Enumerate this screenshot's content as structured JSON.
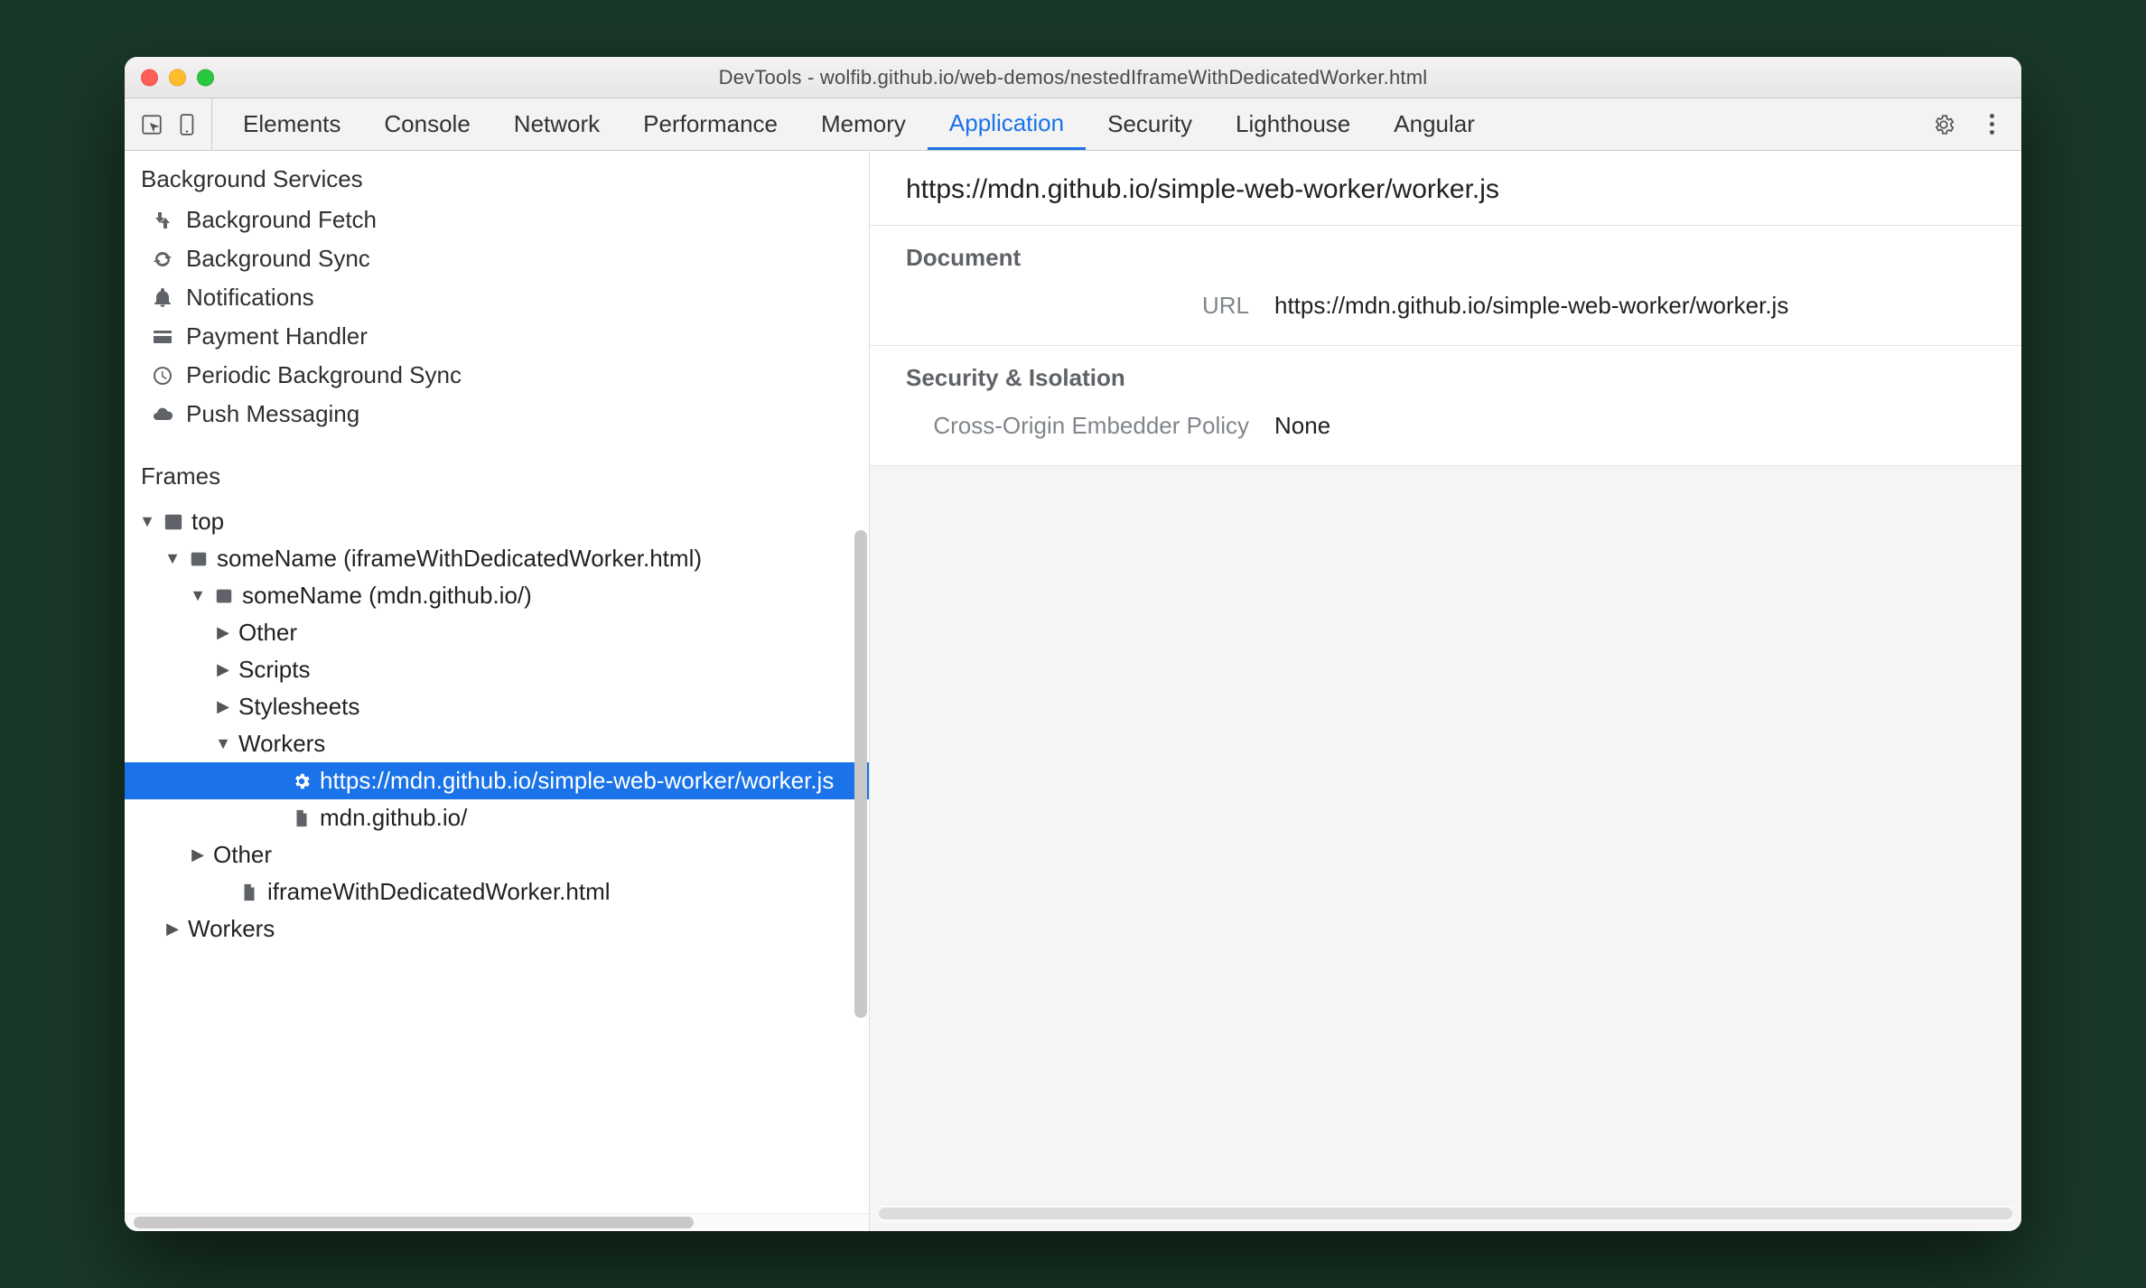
{
  "window": {
    "title": "DevTools - wolfib.github.io/web-demos/nestedIframeWithDedicatedWorker.html"
  },
  "tabs": [
    {
      "label": "Elements",
      "active": false
    },
    {
      "label": "Console",
      "active": false
    },
    {
      "label": "Network",
      "active": false
    },
    {
      "label": "Performance",
      "active": false
    },
    {
      "label": "Memory",
      "active": false
    },
    {
      "label": "Application",
      "active": true
    },
    {
      "label": "Security",
      "active": false
    },
    {
      "label": "Lighthouse",
      "active": false
    },
    {
      "label": "Angular",
      "active": false
    }
  ],
  "sidebar": {
    "bg_services_title": "Background Services",
    "bg_services": [
      {
        "label": "Background Fetch",
        "icon": "fetch"
      },
      {
        "label": "Background Sync",
        "icon": "sync"
      },
      {
        "label": "Notifications",
        "icon": "bell"
      },
      {
        "label": "Payment Handler",
        "icon": "card"
      },
      {
        "label": "Periodic Background Sync",
        "icon": "clock"
      },
      {
        "label": "Push Messaging",
        "icon": "cloud"
      }
    ],
    "frames_title": "Frames",
    "tree": [
      {
        "depth": 1,
        "exp": "open",
        "icon": "window",
        "label": "top"
      },
      {
        "depth": 2,
        "exp": "open",
        "icon": "frame",
        "label": "someName (iframeWithDedicatedWorker.html)"
      },
      {
        "depth": 3,
        "exp": "open",
        "icon": "frame",
        "label": "someName (mdn.github.io/)"
      },
      {
        "depth": 4,
        "exp": "closed",
        "icon": "",
        "label": "Other"
      },
      {
        "depth": 4,
        "exp": "closed",
        "icon": "",
        "label": "Scripts"
      },
      {
        "depth": 4,
        "exp": "closed",
        "icon": "",
        "label": "Stylesheets"
      },
      {
        "depth": 4,
        "exp": "open",
        "icon": "",
        "label": "Workers"
      },
      {
        "depth": 5,
        "exp": "none",
        "icon": "gear",
        "label": "https://mdn.github.io/simple-web-worker/worker.js",
        "selected": true,
        "indent": 6
      },
      {
        "depth": 5,
        "exp": "none",
        "icon": "file",
        "label": "mdn.github.io/",
        "indent": 6
      },
      {
        "depth": 3,
        "exp": "closed",
        "icon": "",
        "label": "Other"
      },
      {
        "depth": 3,
        "exp": "none",
        "icon": "file",
        "label": "iframeWithDedicatedWorker.html",
        "indent": 4
      },
      {
        "depth": 2,
        "exp": "closed",
        "icon": "",
        "label": "Workers"
      }
    ]
  },
  "main": {
    "header": "https://mdn.github.io/simple-web-worker/worker.js",
    "sections": [
      {
        "title": "Document",
        "rows": [
          {
            "k": "URL",
            "v": "https://mdn.github.io/simple-web-worker/worker.js"
          }
        ]
      },
      {
        "title": "Security & Isolation",
        "rows": [
          {
            "k": "Cross-Origin Embedder Policy",
            "v": "None"
          }
        ]
      }
    ]
  }
}
